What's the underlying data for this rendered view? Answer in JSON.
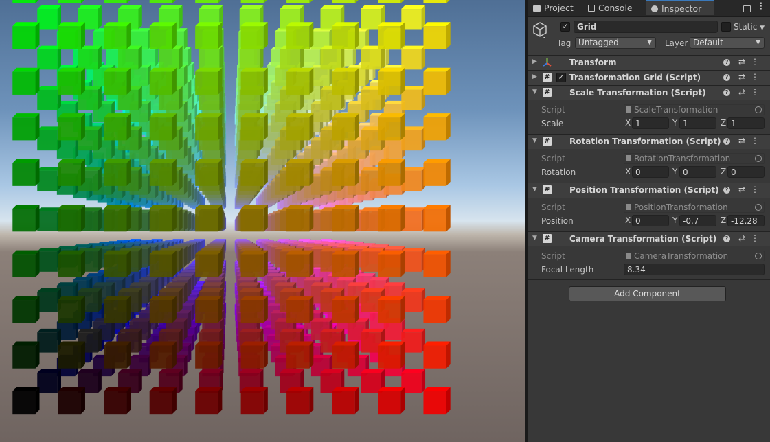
{
  "tabs": [
    {
      "label": "Project",
      "icon": "folder-icon"
    },
    {
      "label": "Console",
      "icon": "console-icon"
    },
    {
      "label": "Inspector",
      "icon": "info-icon"
    }
  ],
  "object": {
    "name": "Grid",
    "active": true,
    "static_label": "Static",
    "tag_label": "Tag",
    "tag_value": "Untagged",
    "layer_label": "Layer",
    "layer_value": "Default"
  },
  "components": {
    "transform": {
      "title": "Transform"
    },
    "grid": {
      "title": "Transformation Grid (Script)",
      "enabled": true
    },
    "scale": {
      "title": "Scale Transformation (Script)",
      "script_label": "Script",
      "script_value": "ScaleTransformation",
      "prop_label": "Scale",
      "x": "1",
      "y": "1",
      "z": "1"
    },
    "rotation": {
      "title": "Rotation Transformation (Script)",
      "script_label": "Script",
      "script_value": "RotationTransformation",
      "prop_label": "Rotation",
      "x": "0",
      "y": "0",
      "z": "0"
    },
    "position": {
      "title": "Position Transformation (Script)",
      "script_label": "Script",
      "script_value": "PositionTransformation",
      "prop_label": "Position",
      "x": "0",
      "y": "-0.7",
      "z": "-12.28"
    },
    "camera": {
      "title": "Camera Transformation (Script)",
      "script_label": "Script",
      "script_value": "CameraTransformation",
      "prop_label": "Focal Length",
      "value": "8.34"
    }
  },
  "axis_labels": {
    "x": "X",
    "y": "Y",
    "z": "Z"
  },
  "add_component_label": "Add Component",
  "colors": {
    "accent": "#3a79bb",
    "panel": "#383838",
    "field": "#2a2a2a"
  }
}
